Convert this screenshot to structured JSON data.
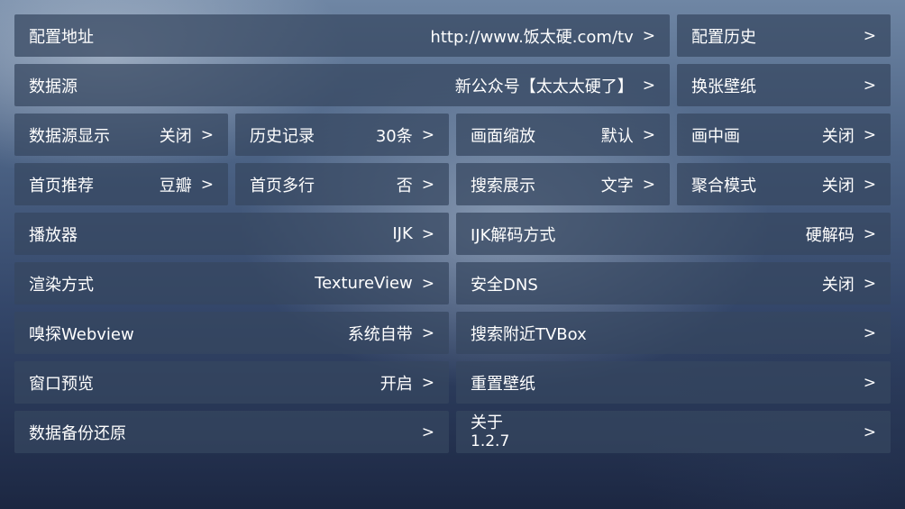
{
  "settings": {
    "config_url": {
      "label": "配置地址",
      "value": "http://www.饭太硬.com/tv",
      "arrow": ">"
    },
    "config_history": {
      "label": "配置历史",
      "arrow": ">"
    },
    "data_source": {
      "label": "数据源",
      "value": "新公众号【太太太硬了】",
      "arrow": ">"
    },
    "change_wallpaper": {
      "label": "换张壁纸",
      "arrow": ">"
    },
    "source_display": {
      "label": "数据源显示",
      "value": "关闭",
      "arrow": ">"
    },
    "history": {
      "label": "历史记录",
      "value": "30条",
      "arrow": ">"
    },
    "scale": {
      "label": "画面缩放",
      "value": "默认",
      "arrow": ">"
    },
    "pip": {
      "label": "画中画",
      "value": "关闭",
      "arrow": ">"
    },
    "home_recommend": {
      "label": "首页推荐",
      "value": "豆瓣",
      "arrow": ">"
    },
    "home_multiline": {
      "label": "首页多行",
      "value": "否",
      "arrow": ">"
    },
    "search_display": {
      "label": "搜索展示",
      "value": "文字",
      "arrow": ">"
    },
    "aggregate_mode": {
      "label": "聚合模式",
      "value": "关闭",
      "arrow": ">"
    },
    "player": {
      "label": "播放器",
      "value": "IJK",
      "arrow": ">"
    },
    "ijk_decode": {
      "label": "IJK解码方式",
      "value": "硬解码",
      "arrow": ">"
    },
    "render_mode": {
      "label": "渲染方式",
      "value": "TextureView",
      "arrow": ">"
    },
    "secure_dns": {
      "label": "安全DNS",
      "value": "关闭",
      "arrow": ">"
    },
    "sniff_webview": {
      "label": "嗅探Webview",
      "value": "系统自带",
      "arrow": ">"
    },
    "search_nearby": {
      "label": "搜索附近TVBox",
      "arrow": ">"
    },
    "window_preview": {
      "label": "窗口预览",
      "value": "开启",
      "arrow": ">"
    },
    "reset_wallpaper": {
      "label": "重置壁纸",
      "arrow": ">"
    },
    "backup_restore": {
      "label": "数据备份还原",
      "arrow": ">"
    },
    "about": {
      "label": "关于",
      "version": "1.2.7",
      "arrow": ">"
    }
  }
}
